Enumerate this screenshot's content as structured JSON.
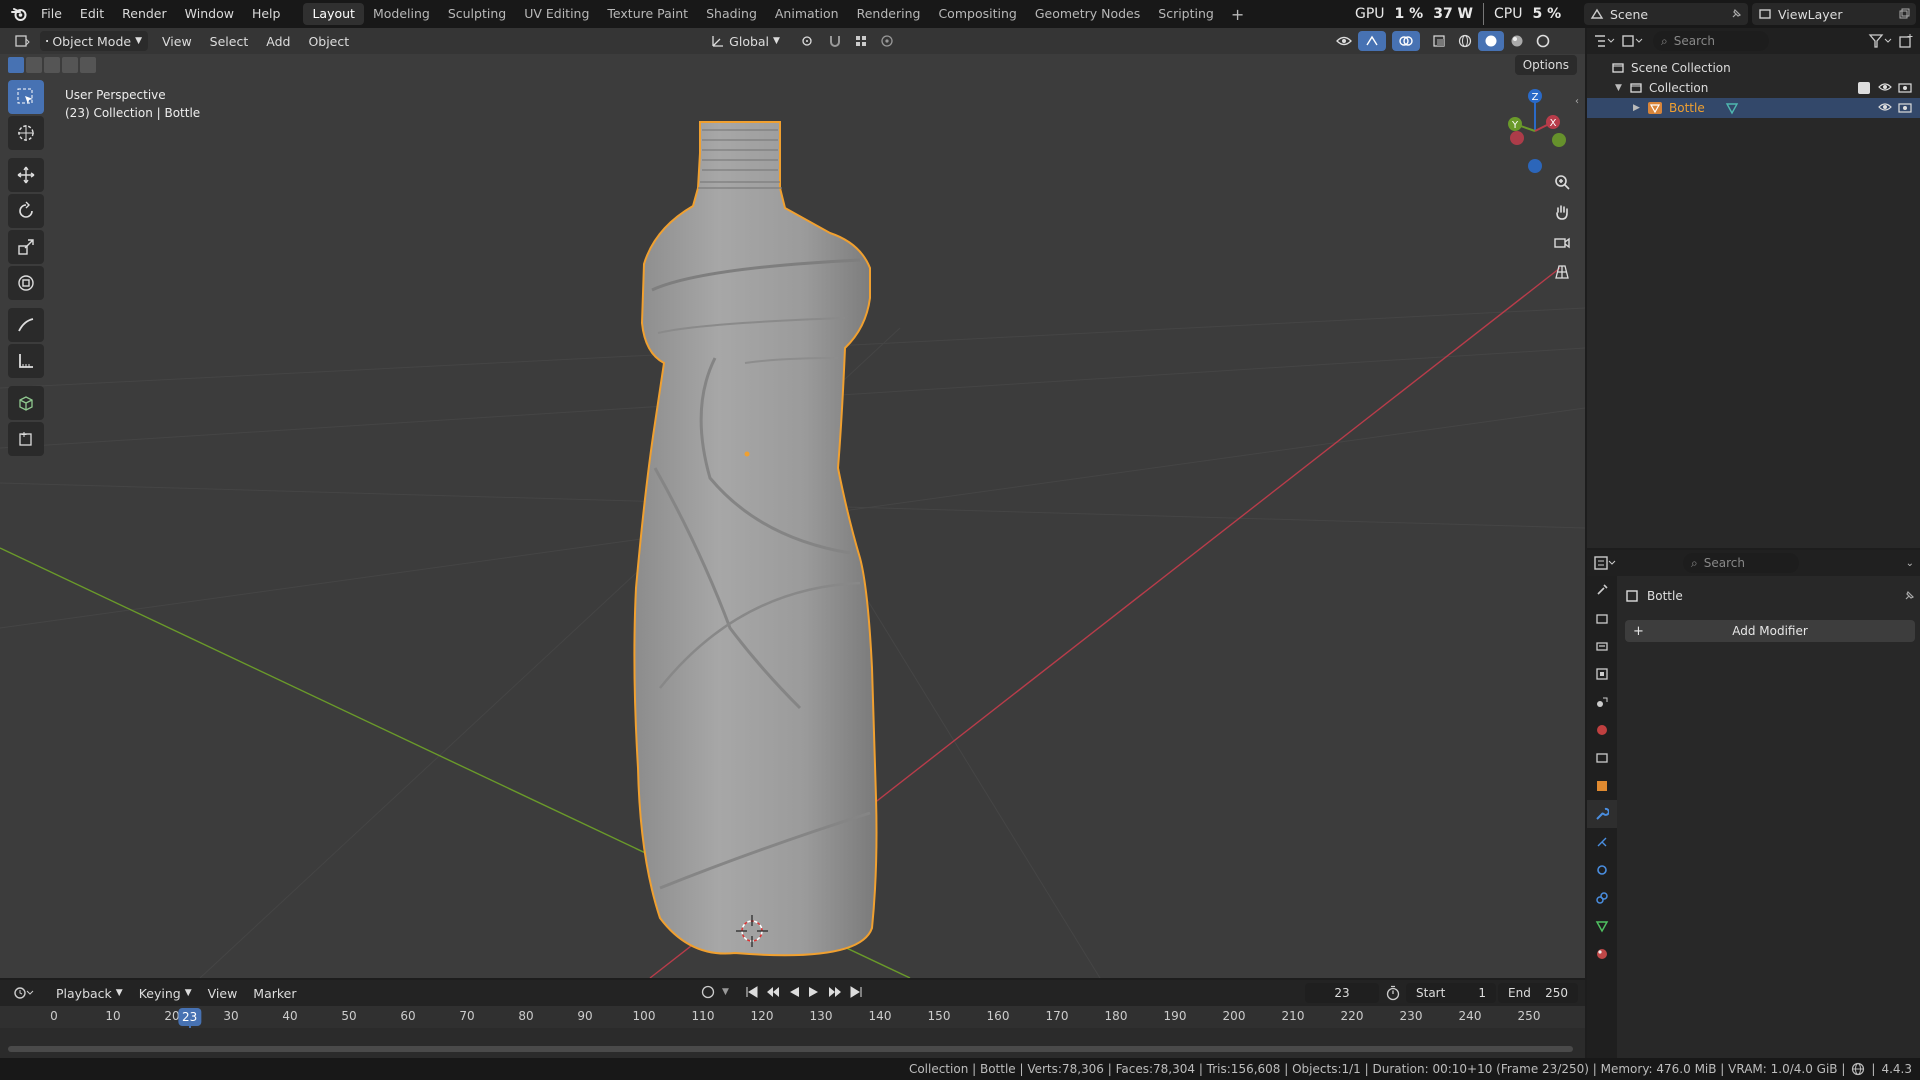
{
  "menu": [
    "File",
    "Edit",
    "Render",
    "Window",
    "Help"
  ],
  "workspaces": [
    {
      "label": "Layout",
      "active": true
    },
    {
      "label": "Modeling"
    },
    {
      "label": "Sculpting"
    },
    {
      "label": "UV Editing"
    },
    {
      "label": "Texture Paint"
    },
    {
      "label": "Shading"
    },
    {
      "label": "Animation"
    },
    {
      "label": "Rendering"
    },
    {
      "label": "Compositing"
    },
    {
      "label": "Geometry Nodes"
    },
    {
      "label": "Scripting"
    }
  ],
  "stats": {
    "gpu_label": "GPU",
    "gpu_value": "1 %",
    "gpu_power": "37 W",
    "cpu_label": "CPU",
    "cpu_value": "5 %"
  },
  "scene": {
    "name": "Scene"
  },
  "view_layer": {
    "name": "ViewLayer"
  },
  "viewport": {
    "mode": "Object Mode",
    "menus": [
      "View",
      "Select",
      "Add",
      "Object"
    ],
    "orientation": "Global",
    "options_label": "Options",
    "perspective": "User Perspective",
    "context": "(23) Collection | Bottle"
  },
  "gizmo": {
    "z": "Z",
    "y": "Y",
    "x": "X"
  },
  "outliner": {
    "search_placeholder": "Search",
    "scene_collection": "Scene Collection",
    "collection": "Collection",
    "object": "Bottle"
  },
  "properties": {
    "search_placeholder": "Search",
    "object_name": "Bottle",
    "add_modifier": "Add Modifier"
  },
  "timeline": {
    "menus": [
      "Playback",
      "Keying",
      "View",
      "Marker"
    ],
    "current_frame": "23",
    "start_label": "Start",
    "start": "1",
    "end_label": "End",
    "end": "250",
    "ticks": [
      "0",
      "10",
      "20",
      "30",
      "40",
      "50",
      "60",
      "70",
      "80",
      "90",
      "100",
      "110",
      "120",
      "130",
      "140",
      "150",
      "160",
      "170",
      "180",
      "190",
      "200",
      "210",
      "220",
      "230",
      "240",
      "250"
    ],
    "playhead": "23"
  },
  "status": {
    "text": "Collection | Bottle | Verts:78,306 | Faces:78,304 | Tris:156,608 | Objects:1/1 | Duration: 00:10+10 (Frame 23/250) | Memory: 476.0 MiB | VRAM: 1.0/4.0 GiB |",
    "version": "4.4.3"
  },
  "colors": {
    "accent": "#4772b3",
    "selection": "#f0a030",
    "x_axis": "#b83c4a",
    "y_axis": "#6a9a2a",
    "z_axis": "#2a6ac8"
  }
}
